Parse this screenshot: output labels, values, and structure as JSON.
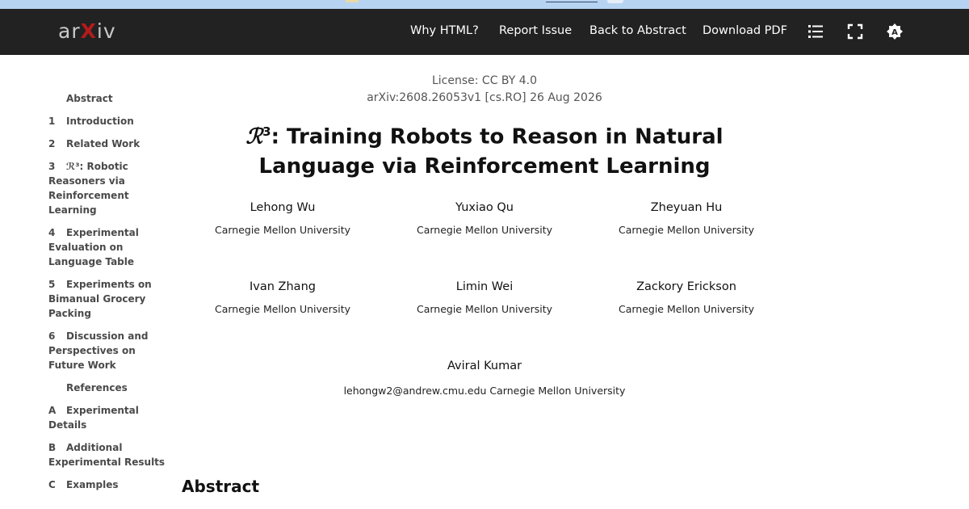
{
  "navbar": {
    "logo": "arXiv",
    "links": [
      "Why HTML?",
      "Report Issue",
      "Back to Abstract",
      "Download PDF"
    ],
    "icons": [
      "list-icon",
      "fullscreen-icon",
      "theme-icon"
    ]
  },
  "toc": [
    {
      "num": "",
      "label": "Abstract"
    },
    {
      "num": "1",
      "label": "Introduction"
    },
    {
      "num": "2",
      "label": "Related Work"
    },
    {
      "num": "3",
      "label": "ℛ³: Robotic Reasoners via Reinforcement Learning"
    },
    {
      "num": "4",
      "label": "Experimental Evaluation on Language Table"
    },
    {
      "num": "5",
      "label": "Experiments on Bimanual Grocery Packing"
    },
    {
      "num": "6",
      "label": "Discussion and Perspectives on Future Work"
    },
    {
      "num": "",
      "label": "References"
    },
    {
      "num": "A",
      "label": "Experimental Details"
    },
    {
      "num": "B",
      "label": "Additional Experimental Results"
    },
    {
      "num": "C",
      "label": "Examples"
    }
  ],
  "paper": {
    "license": "License: CC BY 4.0",
    "arxiv_id": "arXiv:2608.26053v1 [cs.RO] 26 Aug 2026",
    "title_symbol": "ℛ",
    "title_sup": "3",
    "title_line1": ": Training Robots to Reason in Natural",
    "title_line2": "Language via Reinforcement Learning",
    "authors": [
      {
        "name": "Lehong Wu",
        "affil": "Carnegie Mellon University"
      },
      {
        "name": "Yuxiao Qu",
        "affil": "Carnegie Mellon University"
      },
      {
        "name": "Zheyuan Hu",
        "affil": "Carnegie Mellon University"
      },
      {
        "name": "Ivan Zhang",
        "affil": "Carnegie Mellon University"
      },
      {
        "name": "Limin Wei",
        "affil": "Carnegie Mellon University"
      },
      {
        "name": "Zackory Erickson",
        "affil": "Carnegie Mellon University"
      }
    ],
    "last_author": "Aviral Kumar",
    "contact_line": "lehongw2@andrew.cmu.edu Carnegie Mellon University",
    "abstract_heading": "Abstract"
  }
}
